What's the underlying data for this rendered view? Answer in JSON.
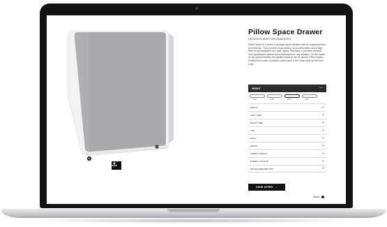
{
  "product": {
    "title": "Pillow Space Drawer",
    "designer": "DESIGN ROBERT BRONWASSER",
    "description": "Pillow Space is a series of acoustic space dividers with an unprecedented performance. They provide visual privacy, sound absorption and a high level of functionality to any open space. Standard or premium acoustic room guarantees optimal sound absorption in any situation. On the inside on the space between the parallel drawers can be placed. Pillow Space Drawers are made of powder coated steel in the same style as the main body.",
    "product_info_link": "Product in stock",
    "download_icon": "download-icon"
  },
  "config": {
    "header": "HEIGHT",
    "header_toggle": "—",
    "sizes": [
      {
        "label": "1000",
        "selected": false
      },
      {
        "label": "1250",
        "selected": false
      },
      {
        "label": "1500",
        "selected": true
      },
      {
        "label": "1750",
        "selected": false
      }
    ],
    "rows": [
      {
        "label": "WIDTH",
        "toggle": "+"
      },
      {
        "label": "LEFT SIDE",
        "toggle": "+"
      },
      {
        "label": "RIGHT SIDE",
        "toggle": "+"
      },
      {
        "label": "TOP",
        "toggle": "+"
      },
      {
        "label": "BACK",
        "toggle": "+"
      },
      {
        "label": "FRONT",
        "toggle": "+"
      },
      {
        "label": "FABRIC GROUP",
        "toggle": "+"
      },
      {
        "label": "FABRIC COLOUR",
        "toggle": "+"
      },
      {
        "label": "SOUND ABSORPTION",
        "toggle": "+"
      }
    ]
  },
  "actions": {
    "send_offer": "SEND OFFER",
    "send_arrow": "→",
    "share": "Share"
  },
  "colors": {
    "fabric": "#a9a9ab",
    "frame": "#f2f2f2",
    "accent": "#111111"
  }
}
